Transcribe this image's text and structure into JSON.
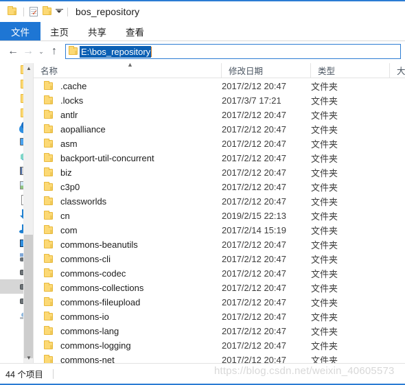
{
  "window": {
    "title": "bos_repository",
    "accent_color": "#2b7cd3"
  },
  "quick_access": {
    "folder_label": "folder-icon",
    "properties_label": "properties-icon",
    "new_folder_label": "new-folder-icon",
    "customize_label": "customize-quick-access"
  },
  "ribbon": {
    "tabs": [
      {
        "label": "文件",
        "active": true
      },
      {
        "label": "主页",
        "active": false
      },
      {
        "label": "共享",
        "active": false
      },
      {
        "label": "查看",
        "active": false
      }
    ]
  },
  "navigation": {
    "back_label": "←",
    "forward_label": "→",
    "history_label": "⌄",
    "up_label": "↑",
    "address_value": "E:\\bos_repository",
    "address_placeholder": "E:\\bos_repository"
  },
  "nav_pane": {
    "items": [
      {
        "icon": "folder-icon",
        "selected": false
      },
      {
        "icon": "folder-icon",
        "selected": false
      },
      {
        "icon": "folder-icon",
        "selected": false
      },
      {
        "icon": "folder-icon",
        "selected": false
      },
      {
        "icon": "onedrive-cloud-icon",
        "selected": false
      },
      {
        "icon": "this-pc-monitor-icon",
        "selected": false
      },
      {
        "icon": "3d-objects-cube-icon",
        "selected": false
      },
      {
        "icon": "videos-film-icon",
        "selected": false
      },
      {
        "icon": "pictures-icon",
        "selected": false
      },
      {
        "icon": "documents-icon",
        "selected": false
      },
      {
        "icon": "downloads-arrow-icon",
        "selected": false
      },
      {
        "icon": "music-note-icon",
        "selected": false
      },
      {
        "icon": "desktop-screen-icon",
        "selected": false
      },
      {
        "icon": "system-drive-icon",
        "selected": false
      },
      {
        "icon": "drive-icon",
        "selected": false
      },
      {
        "icon": "drive-icon",
        "selected": true
      },
      {
        "icon": "drive-icon",
        "selected": false
      },
      {
        "icon": "network-icon",
        "selected": false
      }
    ]
  },
  "file_list": {
    "sort_column": "name",
    "sort_direction": "ascending",
    "columns": [
      {
        "key": "name",
        "label": "名称"
      },
      {
        "key": "date",
        "label": "修改日期"
      },
      {
        "key": "type",
        "label": "类型"
      },
      {
        "key": "size",
        "label": "大小"
      }
    ],
    "rows": [
      {
        "name": ".cache",
        "date": "2017/2/12 20:47",
        "type": "文件夹",
        "size": ""
      },
      {
        "name": ".locks",
        "date": "2017/3/7 17:21",
        "type": "文件夹",
        "size": ""
      },
      {
        "name": "antlr",
        "date": "2017/2/12 20:47",
        "type": "文件夹",
        "size": ""
      },
      {
        "name": "aopalliance",
        "date": "2017/2/12 20:47",
        "type": "文件夹",
        "size": ""
      },
      {
        "name": "asm",
        "date": "2017/2/12 20:47",
        "type": "文件夹",
        "size": ""
      },
      {
        "name": "backport-util-concurrent",
        "date": "2017/2/12 20:47",
        "type": "文件夹",
        "size": ""
      },
      {
        "name": "biz",
        "date": "2017/2/12 20:47",
        "type": "文件夹",
        "size": ""
      },
      {
        "name": "c3p0",
        "date": "2017/2/12 20:47",
        "type": "文件夹",
        "size": ""
      },
      {
        "name": "classworlds",
        "date": "2017/2/12 20:47",
        "type": "文件夹",
        "size": ""
      },
      {
        "name": "cn",
        "date": "2019/2/15 22:13",
        "type": "文件夹",
        "size": ""
      },
      {
        "name": "com",
        "date": "2017/2/14 15:19",
        "type": "文件夹",
        "size": ""
      },
      {
        "name": "commons-beanutils",
        "date": "2017/2/12 20:47",
        "type": "文件夹",
        "size": ""
      },
      {
        "name": "commons-cli",
        "date": "2017/2/12 20:47",
        "type": "文件夹",
        "size": ""
      },
      {
        "name": "commons-codec",
        "date": "2017/2/12 20:47",
        "type": "文件夹",
        "size": ""
      },
      {
        "name": "commons-collections",
        "date": "2017/2/12 20:47",
        "type": "文件夹",
        "size": ""
      },
      {
        "name": "commons-fileupload",
        "date": "2017/2/12 20:47",
        "type": "文件夹",
        "size": ""
      },
      {
        "name": "commons-io",
        "date": "2017/2/12 20:47",
        "type": "文件夹",
        "size": ""
      },
      {
        "name": "commons-lang",
        "date": "2017/2/12 20:47",
        "type": "文件夹",
        "size": ""
      },
      {
        "name": "commons-logging",
        "date": "2017/2/12 20:47",
        "type": "文件夹",
        "size": ""
      },
      {
        "name": "commons-net",
        "date": "2017/2/12 20:47",
        "type": "文件夹",
        "size": ""
      }
    ]
  },
  "status_bar": {
    "item_count": "44 个项目"
  },
  "watermark": {
    "text": "https://blog.csdn.net/weixin_40605573"
  }
}
